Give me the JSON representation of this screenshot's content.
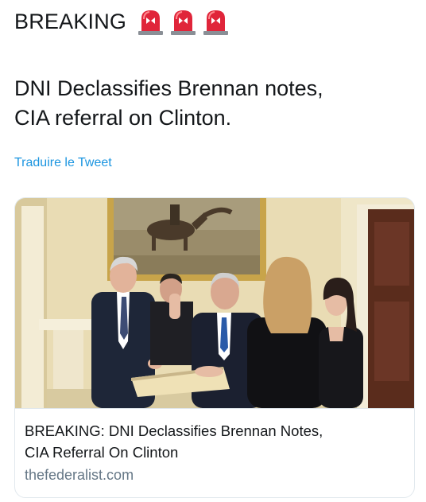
{
  "tweet": {
    "header_text": "BREAKING",
    "header_emoji": [
      "police-siren",
      "police-siren",
      "police-siren"
    ],
    "body_lines": [
      "DNI Declassifies Brennan notes,",
      "CIA referral on Clinton."
    ],
    "translate_link": "Traduire le Tweet",
    "link_color": "#1b95e0"
  },
  "card": {
    "title_lines": [
      "BREAKING: DNI Declassifies Brennan Notes,",
      "CIA Referral On Clinton"
    ],
    "domain": "thefederalist.com",
    "image_icon": "swearing-in-ceremony-photo"
  },
  "colors": {
    "text": "#14171a",
    "secondary_text": "#657786",
    "border": "#e1e8ed",
    "siren_red": "#e0253a"
  }
}
